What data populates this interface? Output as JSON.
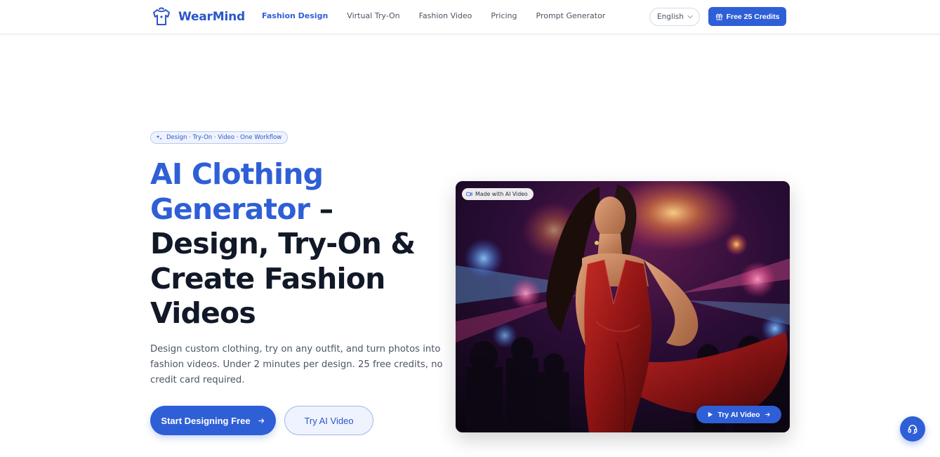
{
  "brand": {
    "name": "WearMind",
    "logo_icon": "shirt-icon"
  },
  "nav": {
    "items": [
      {
        "label": "Fashion Design",
        "active": true
      },
      {
        "label": "Virtual Try-On",
        "active": false
      },
      {
        "label": "Fashion Video",
        "active": false
      },
      {
        "label": "Pricing",
        "active": false
      },
      {
        "label": "Prompt Generator",
        "active": false
      }
    ]
  },
  "header": {
    "language": "English",
    "credits_button": "Free 25 Credits"
  },
  "hero": {
    "pill": "Design · Try-On · Video · One Workflow",
    "headline_blue": "AI Clothing Generator",
    "headline_rest": " – Design, Try-On & Create Fashion Videos",
    "description": "Design custom clothing, try on any outfit, and turn photos into fashion videos. Under 2 minutes per design. 25 free credits, no credit card required.",
    "primary_cta": "Start Designing Free",
    "secondary_cta": "Try AI Video"
  },
  "video_card": {
    "badge": "Made with AI Video",
    "cta": "Try AI Video"
  },
  "colors": {
    "accent": "#2f5fd6",
    "text_dark": "#111827",
    "text_muted": "#4b5563",
    "dress_red": "#8e1414"
  },
  "icons": {
    "credits": "gift-icon",
    "pill": "sparkle-icon",
    "primary_arrow": "arrow-right-icon",
    "badge": "video-camera-icon",
    "play": "play-icon",
    "support": "headset-icon",
    "language": "chevron-down-icon"
  }
}
